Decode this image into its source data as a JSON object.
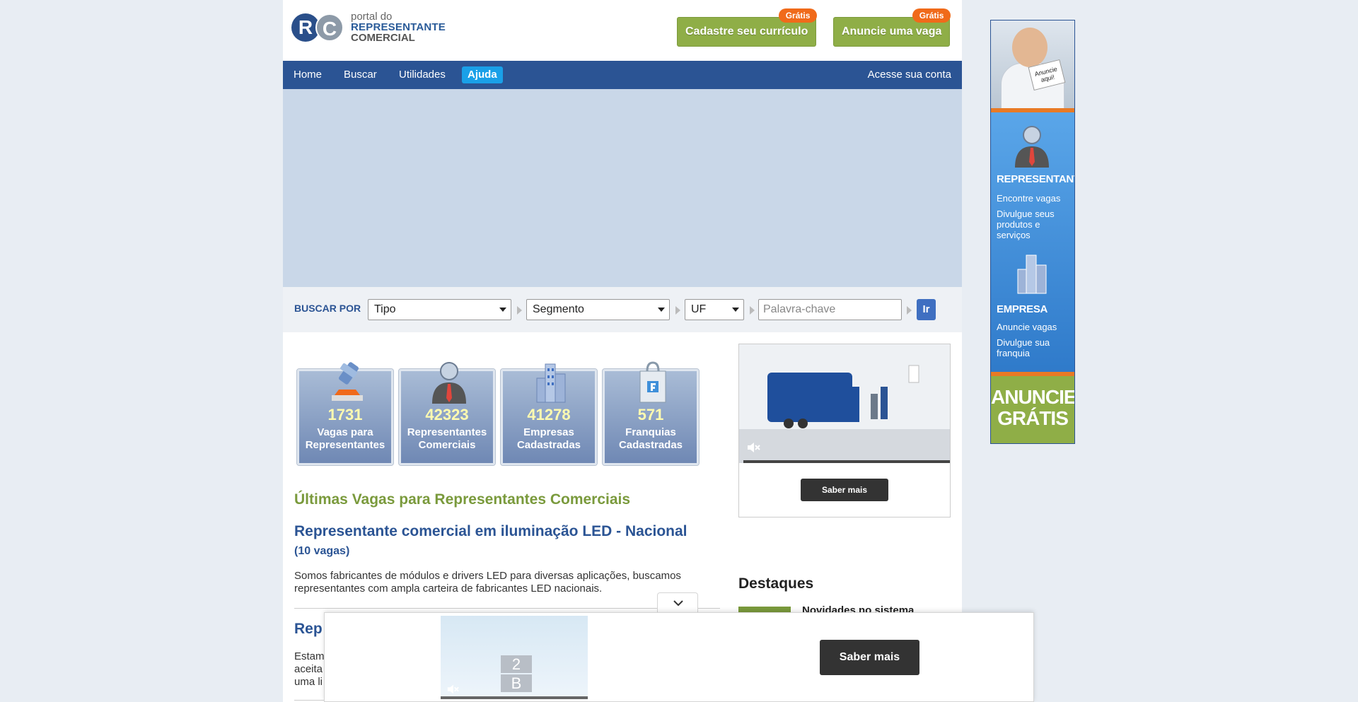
{
  "header": {
    "logo": {
      "letter_r": "R",
      "letter_c": "C",
      "line1": "portal do",
      "line2": "REPRESENTANTE",
      "line3": "COMERCIAL"
    },
    "cta_curriculo": {
      "label": "Cadastre seu currículo",
      "badge": "Grátis"
    },
    "cta_vaga": {
      "label": "Anuncie uma vaga",
      "badge": "Grátis"
    }
  },
  "nav": {
    "home": "Home",
    "buscar": "Buscar",
    "utilidades": "Utilidades",
    "ajuda": "Ajuda",
    "conta": "Acesse sua conta"
  },
  "search": {
    "label": "BUSCAR POR",
    "tipo": "Tipo",
    "segmento": "Segmento",
    "uf": "UF",
    "keyword_placeholder": "Palavra-chave",
    "keyword_value": "",
    "go": "Ir"
  },
  "stats": [
    {
      "value": "1731",
      "label": "Vagas para Representantes",
      "icon": "gavel-icon"
    },
    {
      "value": "42323",
      "label": "Representantes Comerciais",
      "icon": "representative-icon"
    },
    {
      "value": "41278",
      "label": "Empresas Cadastradas",
      "icon": "building-icon"
    },
    {
      "value": "571",
      "label": "Franquias Cadastradas",
      "icon": "franchise-bag-icon"
    }
  ],
  "section_title": "Últimas Vagas para Representantes Comerciais",
  "jobs": [
    {
      "title": "Representante comercial em iluminação LED - Nacional",
      "count": "(10 vagas)",
      "description": "Somos fabricantes de módulos e drivers LED para diversas aplicações, buscamos representantes com ampla carteira de fabricantes LED nacionais."
    },
    {
      "title": "Rep",
      "description": "Estam aceita uma li"
    }
  ],
  "video_ad": {
    "button": "Saber mais"
  },
  "destaques": {
    "title": "Destaques",
    "item": "Novidades no sistema"
  },
  "side_ad": {
    "card": "Anuncie aqui!",
    "representante": "REPRESENTANTE",
    "repr_line1": "Encontre vagas",
    "repr_line2": "Divulgue seus produtos e serviços",
    "empresa": "EMPRESA",
    "emp_line1": "Anuncie vagas",
    "emp_line2": "Divulgue sua franquia",
    "anuncie": "ANUNCIE GRÁTIS"
  },
  "sticky_ad": {
    "button": "Saber mais",
    "box1": "2",
    "box2": "B"
  },
  "colors": {
    "brand_blue": "#2b5494",
    "accent_green": "#8fae47",
    "badge_orange": "#f06a1a",
    "ajuda_blue": "#1aa0e8"
  }
}
